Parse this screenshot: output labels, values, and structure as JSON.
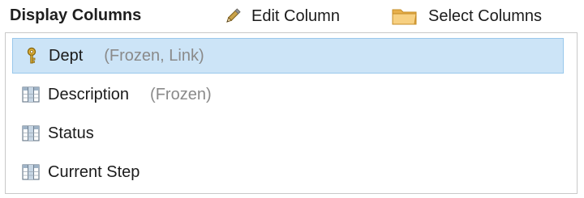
{
  "header": {
    "title": "Display Columns",
    "edit_label": "Edit Column",
    "select_label": "Select Columns"
  },
  "columns": [
    {
      "name": "Dept",
      "note": "(Frozen, Link)",
      "icon": "key-icon",
      "selected": true
    },
    {
      "name": "Description",
      "note": "(Frozen)",
      "icon": "table-column-icon",
      "selected": false
    },
    {
      "name": "Status",
      "note": "",
      "icon": "table-column-icon",
      "selected": false
    },
    {
      "name": "Current Step",
      "note": "",
      "icon": "table-column-icon",
      "selected": false
    }
  ],
  "colors": {
    "selection_bg": "#cce4f7",
    "selection_border": "#99c8ec",
    "note_text": "#8a8a8a"
  }
}
